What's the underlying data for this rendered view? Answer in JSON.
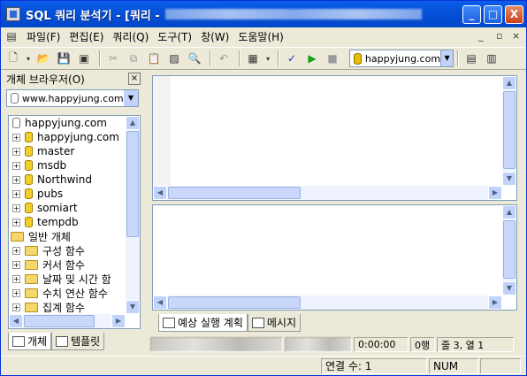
{
  "window": {
    "title": "SQL 쿼리 분석기 - [쿼리 -",
    "controls": {
      "minimize": "_",
      "maximize": "□",
      "close": "X"
    }
  },
  "menubar": {
    "items": [
      "파일(F)",
      "편집(E)",
      "쿼리(Q)",
      "도구(T)",
      "창(W)",
      "도움말(H)"
    ],
    "mdi_controls": [
      "_",
      "▫",
      "×"
    ]
  },
  "toolbar": {
    "database": "happyjung.com",
    "icons": [
      "new-query-icon",
      "dropdown-arrow-icon",
      "open-icon",
      "save-icon",
      "load-icon",
      "cut-icon",
      "copy-icon",
      "paste-icon",
      "clear-icon",
      "find-icon",
      "undo-icon",
      "results-grid-icon",
      "dropdown-arrow-icon",
      "parse-icon",
      "execute-icon",
      "stop-icon",
      "database-selector",
      "object-browser-icon",
      "object-search-icon"
    ]
  },
  "object_browser": {
    "title": "개체 브라우저(O)",
    "close": "×",
    "server": "www.happyjung.com",
    "tree_root": "happyjung.com",
    "databases": [
      "happyjung.com",
      "master",
      "msdb",
      "Northwind",
      "pubs",
      "somiart",
      "tempdb"
    ],
    "common_objects_label": "일반 개체",
    "common_objects": [
      "구성 함수",
      "커서 함수",
      "날짜 및 시간 함",
      "수치 연산 함수",
      "집계 함수"
    ],
    "tabs": [
      "개체",
      "템플릿"
    ]
  },
  "results": {
    "tabs": [
      "예상 실행 계획",
      "메시지"
    ]
  },
  "query_status": {
    "elapsed": "0:00:00",
    "rows": "0행",
    "position": "줄 3, 열 1"
  },
  "status_bar": {
    "connections": "연결 수: 1",
    "num": "NUM"
  },
  "colors": {
    "titlebar": "#0550d8",
    "panel_bg": "#ece9d8",
    "scroll_button": "#c1d3fb",
    "execute_green": "#14a014",
    "parse_blue": "#1a3ad0"
  }
}
